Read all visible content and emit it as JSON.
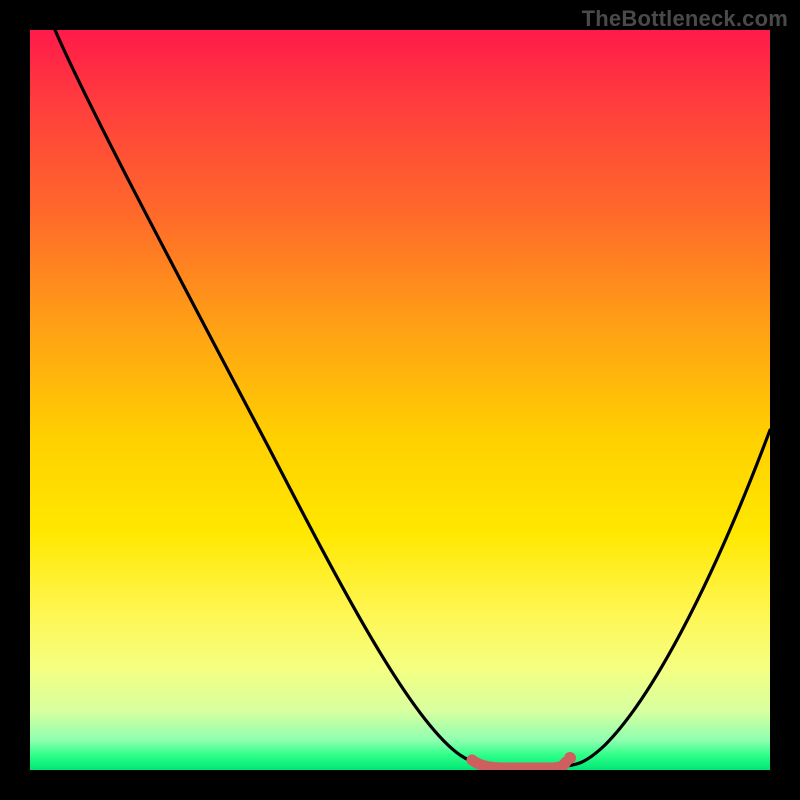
{
  "attribution": "TheBottleneck.com",
  "chart_data": {
    "type": "line",
    "title": "",
    "xlabel": "",
    "ylabel": "",
    "xlim": [
      0,
      100
    ],
    "ylim": [
      0,
      100
    ],
    "background_gradient": {
      "top": "#ff1a4a",
      "bottom": "#00e676"
    },
    "series": [
      {
        "name": "bottleneck-curve",
        "color": "#000000",
        "x": [
          5,
          10,
          20,
          30,
          40,
          50,
          58,
          62,
          66,
          70,
          75,
          80,
          85,
          90,
          95,
          100
        ],
        "y": [
          100,
          90,
          72,
          54,
          36,
          18,
          4,
          1,
          0,
          0,
          1,
          5,
          12,
          22,
          34,
          48
        ]
      },
      {
        "name": "optimal-range-marker",
        "color": "#d96060",
        "x": [
          61,
          70
        ],
        "y": [
          1,
          1
        ]
      }
    ],
    "optimal_range": {
      "start_x": 61,
      "end_x": 70
    }
  }
}
